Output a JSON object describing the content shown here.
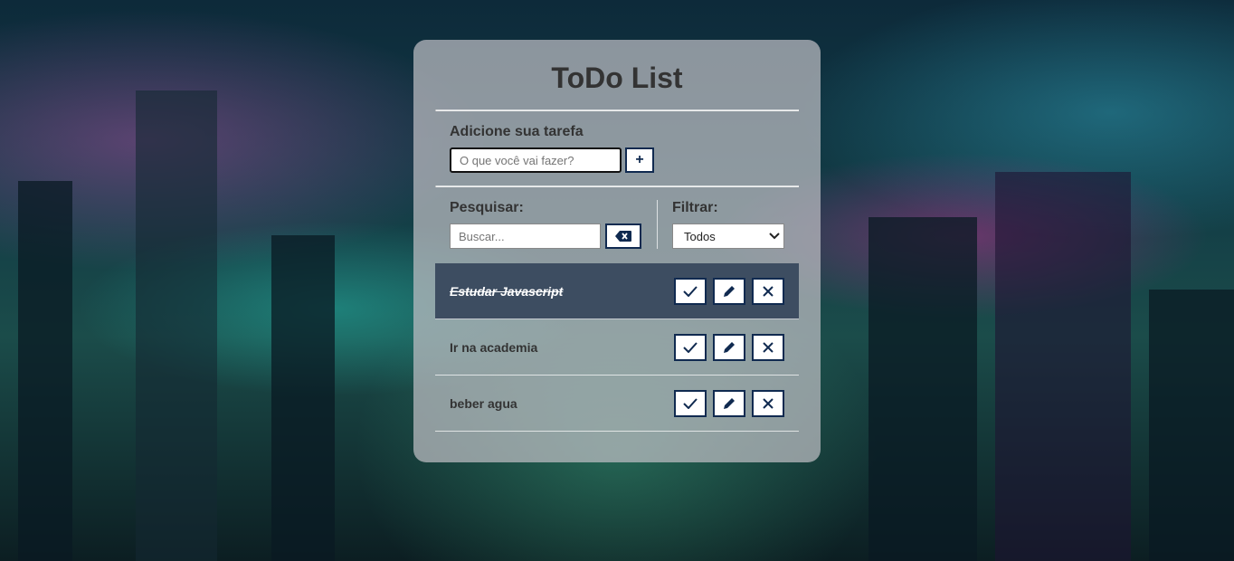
{
  "app": {
    "title": "ToDo List"
  },
  "add_section": {
    "label": "Adicione sua tarefa",
    "placeholder": "O que você vai fazer?",
    "add_button_label": "+"
  },
  "search_section": {
    "label": "Pesquisar:",
    "placeholder": "Buscar..."
  },
  "filter_section": {
    "label": "Filtrar:",
    "selected": "Todos"
  },
  "todos": [
    {
      "text": "Estudar Javascript",
      "done": true
    },
    {
      "text": "Ir na academia",
      "done": false
    },
    {
      "text": "beber agua",
      "done": false
    }
  ],
  "icons": {
    "add": "plus-icon",
    "clear": "backspace-icon",
    "done": "check-icon",
    "edit": "pencil-icon",
    "remove": "close-icon",
    "dropdown": "chevron-down-icon"
  },
  "colors": {
    "accent": "#102a50",
    "done_row": "#3d4d61",
    "card": "#bebec3"
  }
}
